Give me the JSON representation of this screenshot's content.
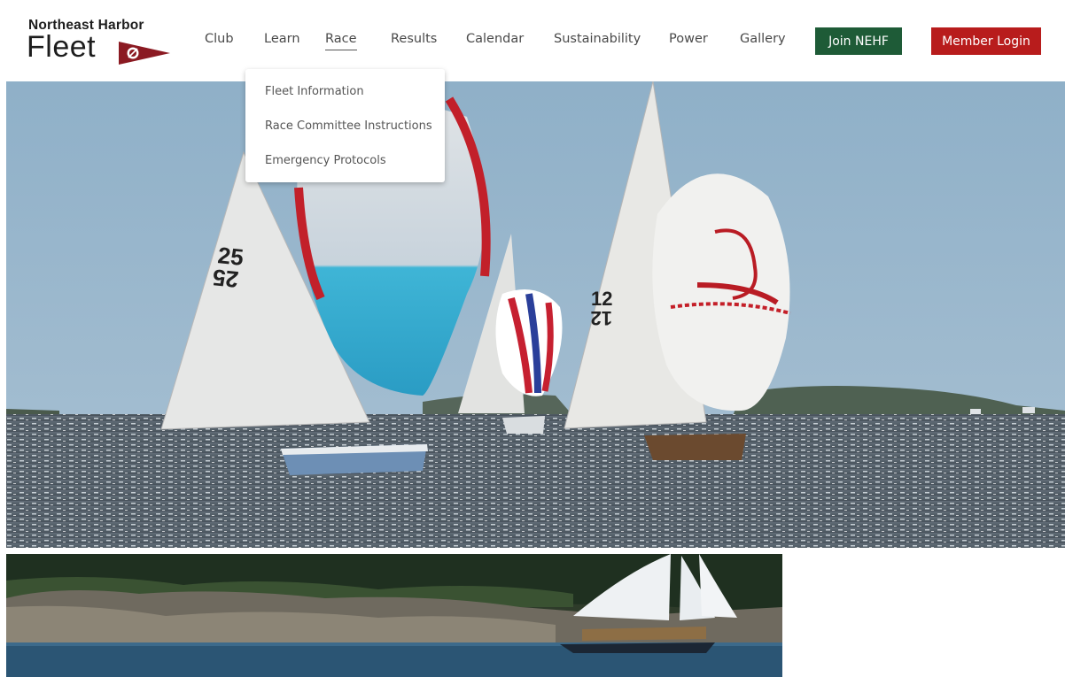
{
  "logo": {
    "line1": "Northeast Harbor",
    "line2": "Fleet"
  },
  "nav": {
    "items": [
      {
        "label": "Club"
      },
      {
        "label": "Learn"
      },
      {
        "label": "Race",
        "active": true
      },
      {
        "label": "Results"
      },
      {
        "label": "Calendar"
      },
      {
        "label": "Sustainability"
      },
      {
        "label": "Power"
      },
      {
        "label": "Gallery"
      }
    ],
    "join_label": "Join NEHF",
    "login_label": "Member Login"
  },
  "race_dropdown": {
    "items": [
      {
        "label": "Fleet Information"
      },
      {
        "label": "Race Committee Instructions"
      },
      {
        "label": "Emergency Protocols"
      }
    ]
  },
  "colors": {
    "join_green": "#1e5b37",
    "login_red": "#b81c1c",
    "flag_red": "#8b1a22"
  },
  "hero": {
    "sail_numbers": [
      "25",
      "12"
    ]
  }
}
